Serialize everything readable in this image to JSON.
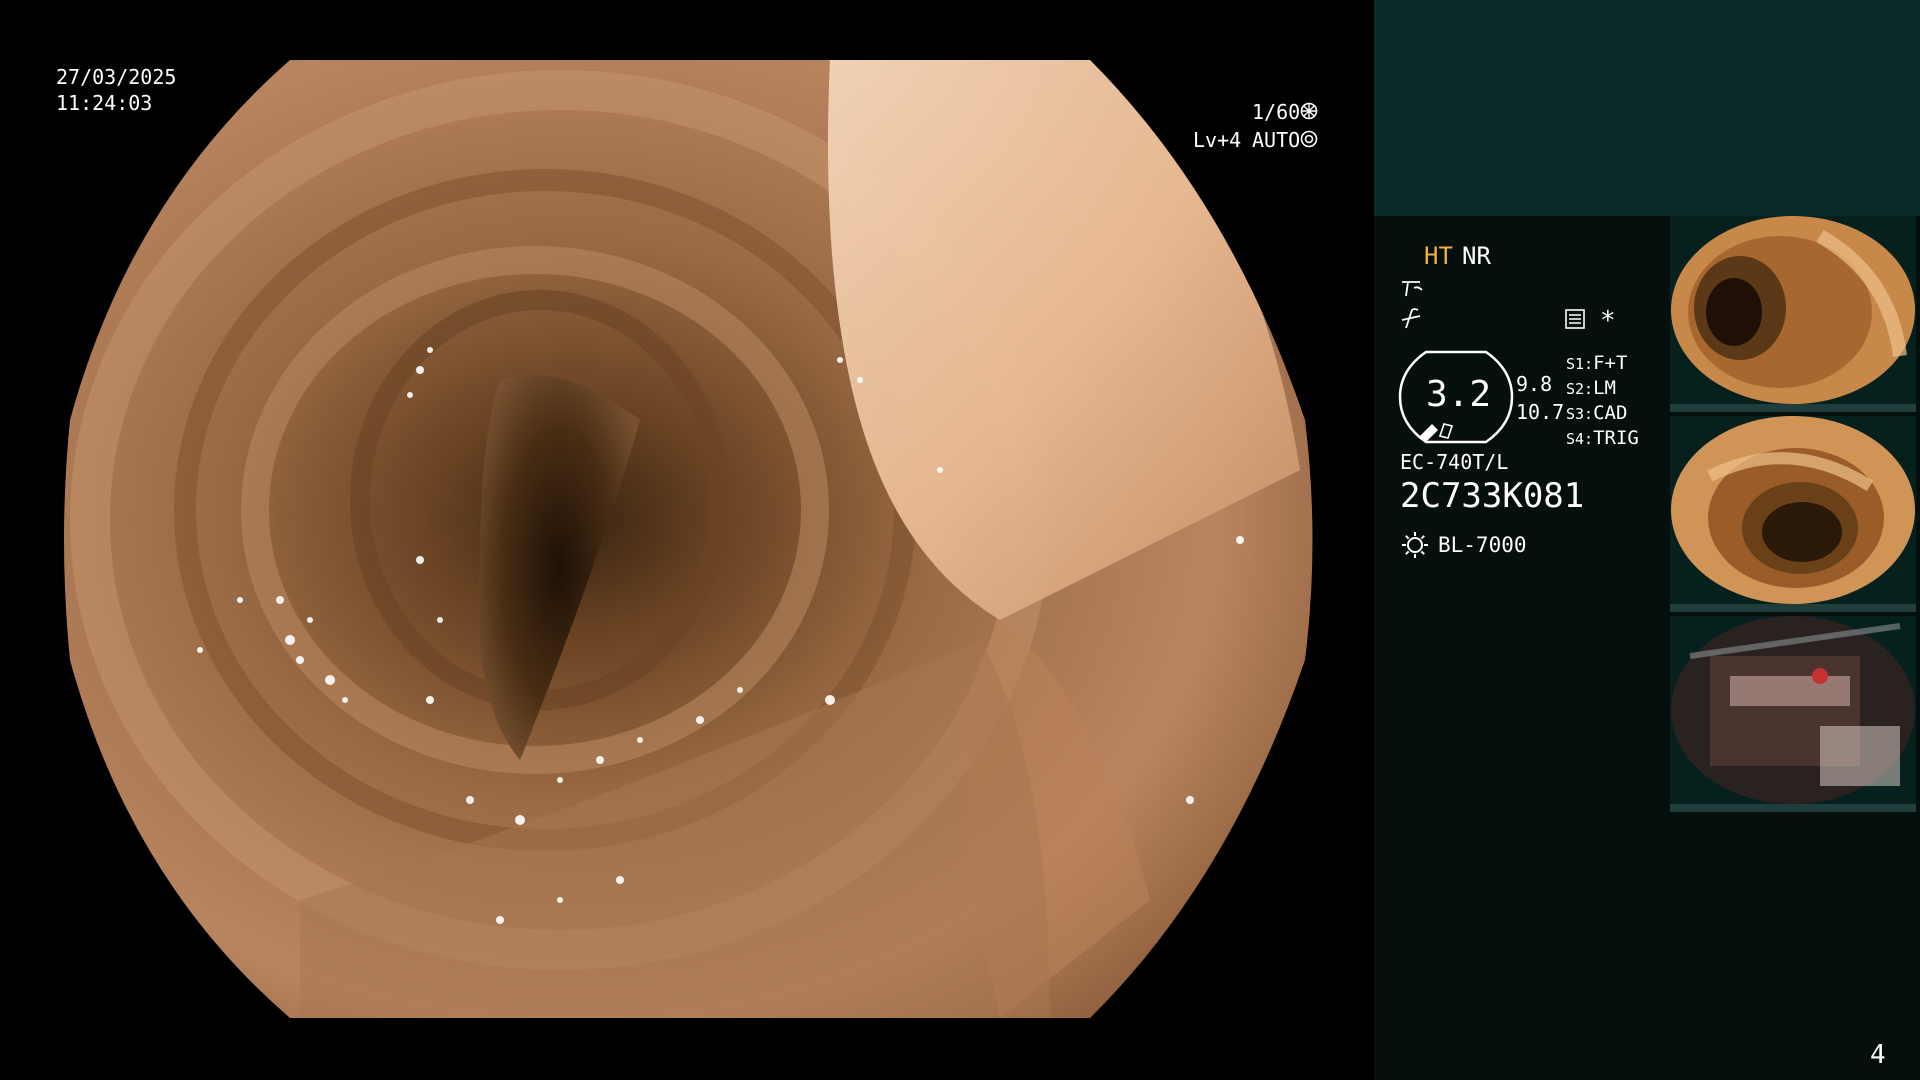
{
  "overlay": {
    "date": "27/03/2025",
    "time": "11:24:03",
    "shutter": "1/60",
    "shutter_icon": "aperture-icon",
    "level": "Lv+4",
    "mode": "AUTO",
    "mode_icon": "iris-icon"
  },
  "panel": {
    "image_mode_primary": "HT",
    "image_mode_secondary": "NR",
    "zoom_value": "3.2",
    "side_value_1": "9.8",
    "side_value_2": "10.7",
    "switches": [
      {
        "key": "S1:",
        "value": "F+T"
      },
      {
        "key": "S2:",
        "value": "LM"
      },
      {
        "key": "S3:",
        "value": "CAD"
      },
      {
        "key": "S4:",
        "value": "TRIG"
      }
    ],
    "star_symbol": "*",
    "scope_model": "EC-740T/L",
    "scope_serial": "2C733K081",
    "light_source": "BL-7000",
    "page_number": "4"
  },
  "colors": {
    "hotkey_orange": "#f0b040",
    "panel_top": "#0d2a2a",
    "panel_main": "#050f0e",
    "tissue_light": "#d9a27a",
    "tissue_dark": "#5a3a1e"
  },
  "thumbnails": [
    {
      "index": "1"
    },
    {
      "index": "2"
    },
    {
      "index": "3"
    }
  ]
}
